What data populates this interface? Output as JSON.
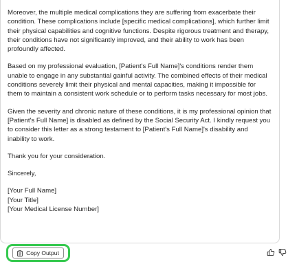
{
  "letter": {
    "paragraphs": [
      "Moreover, the multiple medical complications they are suffering from exacerbate their condition. These complications include [specific medical complications], which further limit their physical capabilities and cognitive functions. Despite rigorous treatment and therapy, their conditions have not significantly improved, and their ability to work has been profoundly affected.",
      "Based on my professional evaluation, [Patient's Full Name]'s conditions render them unable to engage in any substantial gainful activity. The combined effects of their medical conditions severely limit their physical and mental capacities, making it impossible for them to maintain a consistent work schedule or to perform tasks necessary for most jobs.",
      "Given the severity and chronic nature of these conditions, it is my professional opinion that [Patient's Full Name] is disabled as defined by the Social Security Act. I kindly request you to consider this letter as a strong testament to [Patient's Full Name]'s disability and inability to work.",
      "Thank you for your consideration.",
      "Sincerely,"
    ],
    "signature": [
      "[Your Full Name]",
      "[Your Title]",
      "[Your Medical License Number]"
    ]
  },
  "actions": {
    "copy_label": "Copy Output",
    "copy_icon": "clipboard-icon",
    "thumbs_up_icon": "thumbs-up-icon",
    "thumbs_down_icon": "thumbs-down-icon",
    "highlight_color": "#35c94f"
  }
}
